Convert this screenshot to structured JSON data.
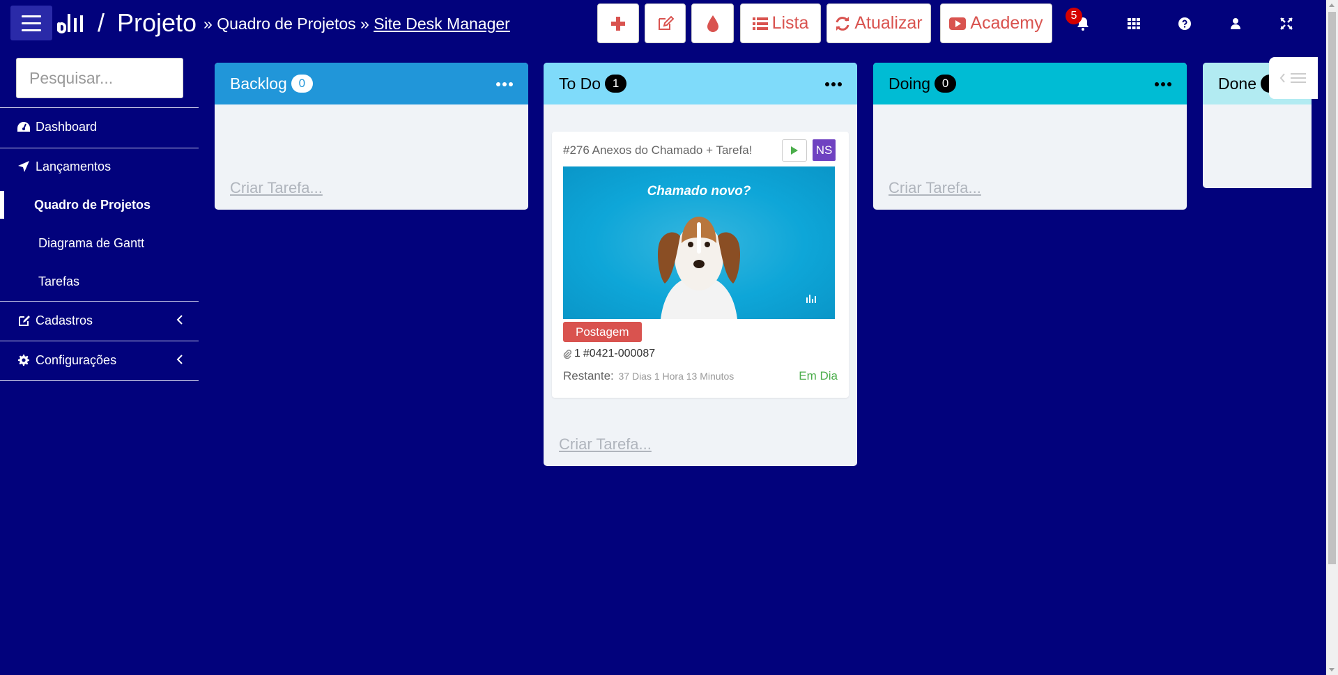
{
  "app": {
    "section": "Projeto",
    "breadcrumb": {
      "sep1": "»",
      "item1": "Quadro de Projetos",
      "sep2": "»",
      "current": "Site Desk Manager"
    }
  },
  "toolbar": {
    "lista_label": "Lista",
    "atualizar_label": "Atualizar",
    "academy_label": "Academy",
    "notification_count": "5",
    "accent_color": "#d9534f"
  },
  "sidebar": {
    "search_placeholder": "Pesquisar...",
    "items": [
      {
        "label": "Dashboard",
        "icon": "dashboard-icon"
      },
      {
        "label": "Lançamentos",
        "icon": "location-arrow-icon"
      },
      {
        "label": "Quadro de Projetos",
        "active": true
      },
      {
        "label": "Diagrama de Gantt"
      },
      {
        "label": "Tarefas"
      },
      {
        "label": "Cadastros",
        "icon": "edit-icon"
      },
      {
        "label": "Configurações",
        "icon": "gear-icon"
      }
    ]
  },
  "board": {
    "columns": [
      {
        "title": "Backlog",
        "count": "0",
        "color": "#2196d9",
        "create_label": "Criar Tarefa..."
      },
      {
        "title": "To Do",
        "count": "1",
        "color": "#7fdbfa",
        "create_label": "Criar Tarefa..."
      },
      {
        "title": "Doing",
        "count": "0",
        "color": "#00bcd4",
        "create_label": "Criar Tarefa..."
      },
      {
        "title": "Done",
        "count": "",
        "color": "#b2ebf2"
      }
    ],
    "card": {
      "title": "#276 Anexos do Chamado + Tarefa!",
      "avatar": "NS",
      "image_caption": "Chamado novo?",
      "tag": "Postagem",
      "attachments": "1",
      "ticket": "#0421-000087",
      "remaining_label": "Restante:",
      "remaining_time": "37 Dias 1 Hora 13 Minutos",
      "status": "Em Dia"
    }
  }
}
